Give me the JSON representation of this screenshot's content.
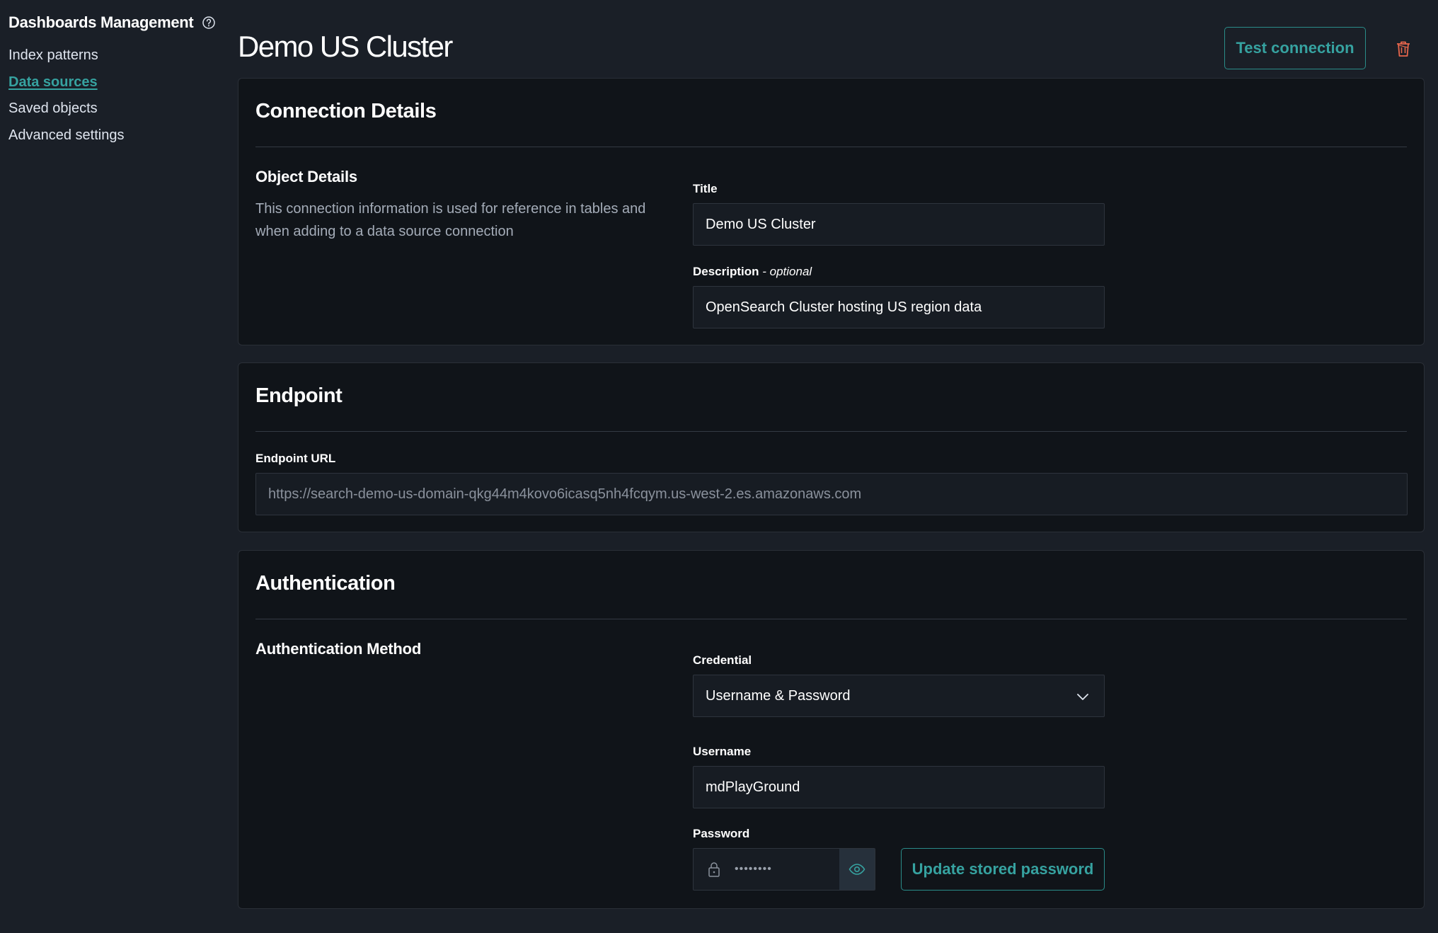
{
  "sidebar": {
    "title": "Dashboards Management",
    "items": [
      {
        "label": "Index patterns",
        "active": false
      },
      {
        "label": "Data sources",
        "active": true
      },
      {
        "label": "Saved objects",
        "active": false
      },
      {
        "label": "Advanced settings",
        "active": false
      }
    ]
  },
  "header": {
    "title": "Demo US Cluster",
    "test_connection_label": "Test connection",
    "delete_icon": "trash-icon"
  },
  "connection_details": {
    "title": "Connection Details",
    "section_title": "Object Details",
    "description": "This connection information is used for reference in tables and when adding to a data source connection",
    "title_label": "Title",
    "title_value": "Demo US Cluster",
    "description_label": "Description",
    "description_optional": " - optional",
    "description_value": "OpenSearch Cluster hosting US region data"
  },
  "endpoint": {
    "title": "Endpoint",
    "url_label": "Endpoint URL",
    "url_value": "https://search-demo-us-domain-qkg44m4kovo6icasq5nh4fcqym.us-west-2.es.amazonaws.com"
  },
  "authentication": {
    "title": "Authentication",
    "section_title": "Authentication Method",
    "credential_label": "Credential",
    "credential_value": "Username & Password",
    "username_label": "Username",
    "username_value": "mdPlayGround",
    "password_label": "Password",
    "password_value": "••••••••",
    "update_password_label": "Update stored password"
  },
  "colors": {
    "background": "#1a1f27",
    "panel": "#101419",
    "accent": "#36a2a0",
    "danger": "#e7664c"
  }
}
